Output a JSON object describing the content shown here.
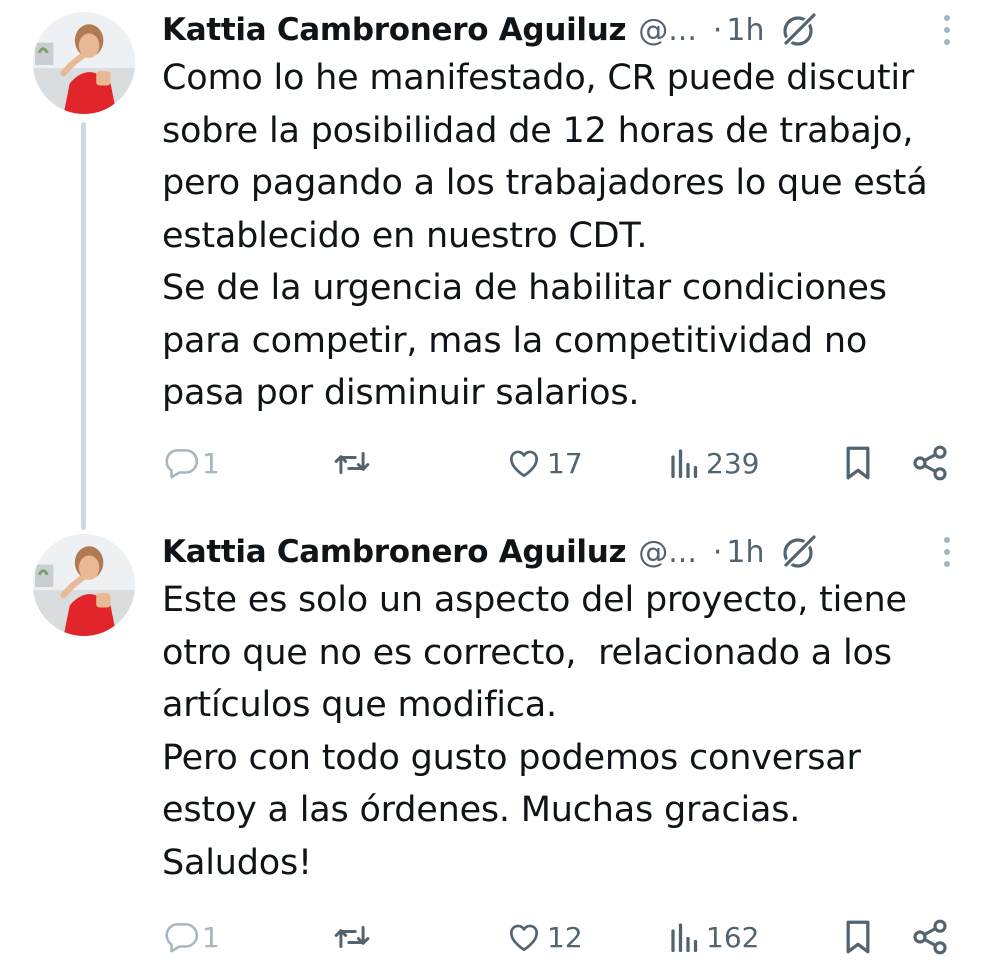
{
  "tweets": [
    {
      "author_name": "Kattia Cambronero Aguiluz",
      "handle": "@...",
      "separator": "·",
      "time": "1h",
      "text_lines": [
        "Como lo he manifestado, CR puede discutir",
        "sobre la posibilidad de 12 horas de trabajo,",
        "pero pagando a los trabajadores lo que está",
        "establecido en nuestro CDT.",
        "Se de la urgencia de habilitar condiciones",
        "para competir, mas la competitividad no",
        "pasa por disminuir salarios."
      ],
      "replies": "1",
      "retweets": "",
      "likes": "17",
      "views": "239"
    },
    {
      "author_name": "Kattia Cambronero Aguiluz",
      "handle": "@...",
      "separator": "·",
      "time": "1h",
      "text_lines": [
        "Este es solo un aspecto del proyecto, tiene",
        "otro que no es correcto,  relacionado a los",
        "artículos que modifica.",
        "Pero con todo gusto podemos conversar",
        "estoy a las órdenes. Muchas gracias.",
        "Saludos!"
      ],
      "replies": "1",
      "retweets": "",
      "likes": "12",
      "views": "162"
    }
  ],
  "icons": {
    "reply": "reply-icon",
    "retweet": "retweet-icon",
    "like": "heart-icon",
    "views": "views-icon",
    "bookmark": "bookmark-icon",
    "share": "share-icon",
    "grok": "grok-icon",
    "more": "more-icon"
  },
  "colors": {
    "text": "#0f1419",
    "secondary": "#536471",
    "thread_line": "#cfd9de",
    "avatar_dress": "#e2252b"
  }
}
